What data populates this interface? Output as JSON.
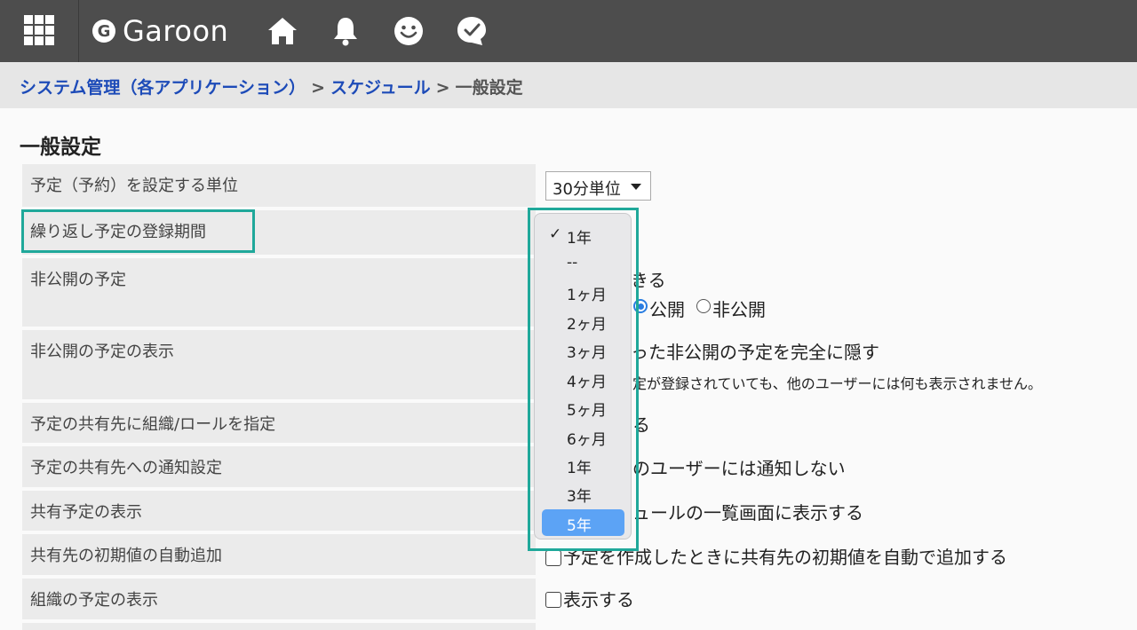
{
  "header": {
    "logo_letter": "G",
    "logo_text": "Garoon",
    "icons": [
      "apps-grid-icon",
      "home-icon",
      "bell-icon",
      "smiley-icon",
      "chat-icon"
    ]
  },
  "breadcrumb": {
    "item1": "システム管理（各アプリケーション）",
    "sep1": ">",
    "item2": "スケジュール",
    "sep2": ">",
    "current": "一般設定"
  },
  "page_title": "一般設定",
  "settings": {
    "unit_label": "予定（予約）を設定する単位",
    "unit_value": "30分単位",
    "repeat_label": "繰り返し予定の登録期間",
    "private_label": "非公開の予定",
    "private_line1_partial": "きる",
    "private_public": "公開",
    "private_private": "非公開",
    "private_display_label": "非公開の予定の表示",
    "private_display_line1_partial": "った非公開の予定を完全に隠す",
    "private_display_line2_partial": "定が登録されていても、他のユーザーには何も表示されません。",
    "share_org_label": "予定の共有先に組織/ロールを指定",
    "share_org_partial": "る",
    "notify_label": "予定の共有先への通知設定",
    "notify_partial": "のユーザーには通知しない",
    "shared_display_label": "共有予定の表示",
    "shared_display_partial": "ュールの一覧画面に表示する",
    "auto_add_label": "共有先の初期値の自動追加",
    "auto_add_text": "予定を作成したときに共有先の初期値を自動で追加する",
    "org_display_label": "組織の予定の表示",
    "org_display_text": "表示する"
  },
  "dropdown": {
    "checkmark": "✓",
    "options": [
      "1年",
      "--",
      "1ヶ月",
      "2ヶ月",
      "3ヶ月",
      "4ヶ月",
      "5ヶ月",
      "6ヶ月",
      "1年",
      "3年",
      "5年"
    ],
    "checked_index": 0,
    "highlighted_index": 10
  },
  "colors": {
    "header_bg": "#4d4d4d",
    "link": "#1d4bb8",
    "highlight_outline": "#1fa89a",
    "selected_option": "#5ca3f5"
  }
}
